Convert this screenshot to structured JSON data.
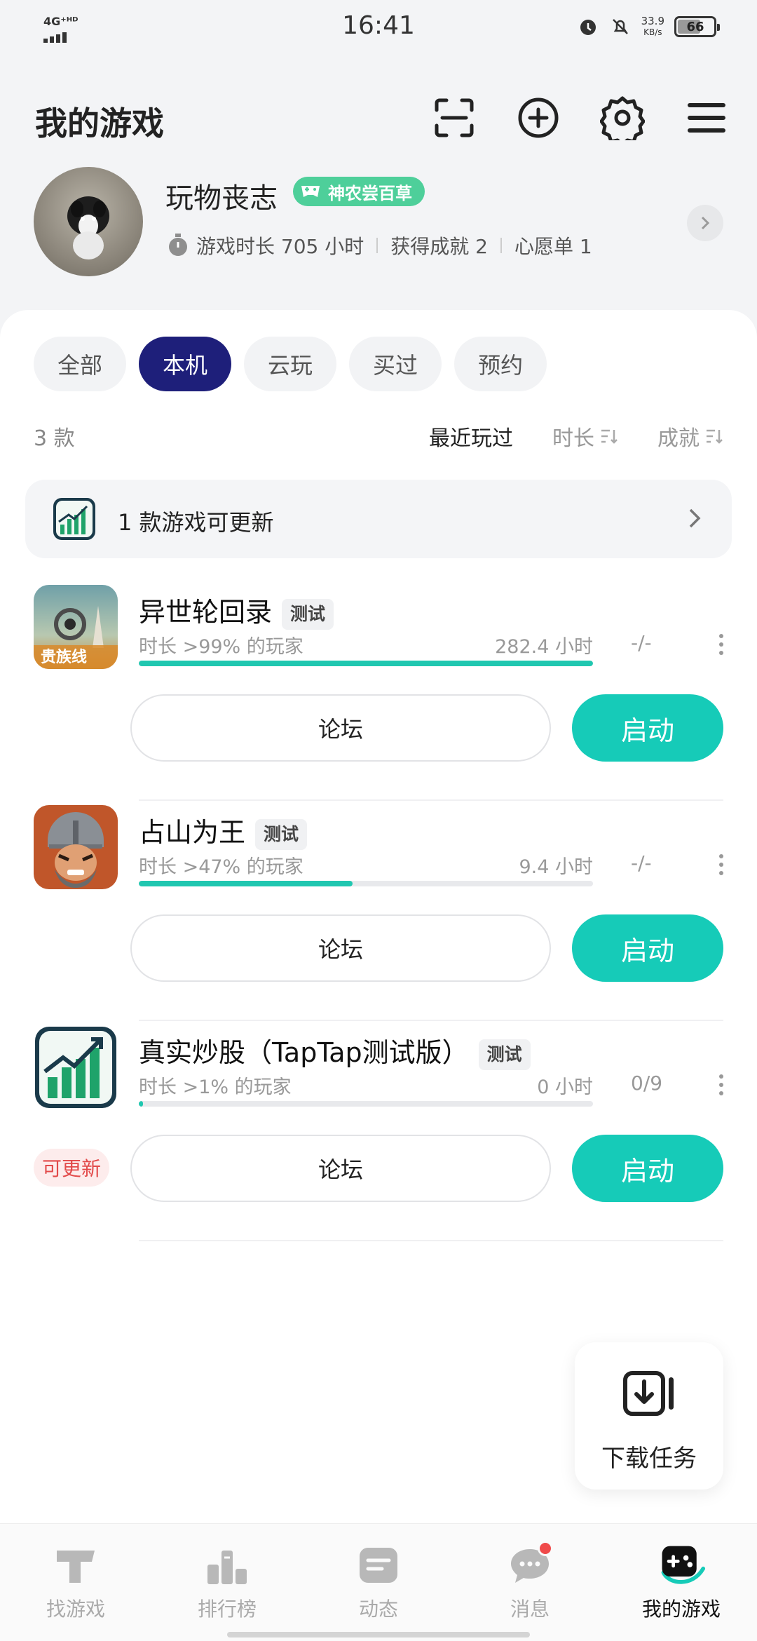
{
  "status_bar": {
    "network": "4G⁺ᴴᴰ",
    "time": "16:41",
    "speed_value": "33.9",
    "speed_unit": "KB/s",
    "battery": "66"
  },
  "header": {
    "title": "我的游戏"
  },
  "profile": {
    "username": "玩物丧志",
    "badge": "神农尝百草",
    "playtime": "游戏时长 705 小时",
    "achievements": "获得成就 2",
    "wishlist": "心愿单 1"
  },
  "filters": {
    "chips": [
      "全部",
      "本机",
      "云玩",
      "买过",
      "预约"
    ],
    "active": "本机"
  },
  "sort": {
    "count": "3 款",
    "recent": "最近玩过",
    "duration": "时长",
    "achievement": "成就"
  },
  "update_banner": {
    "text": "1 款游戏可更新"
  },
  "games": [
    {
      "title": "异世轮回录",
      "tag": "测试",
      "rank_text": "时长 >99% 的玩家",
      "hours": "282.4 小时",
      "progress": 1.0,
      "achievements": "-/-",
      "forum": "论坛",
      "launch": "启动"
    },
    {
      "title": "占山为王",
      "tag": "测试",
      "rank_text": "时长 >47% 的玩家",
      "hours": "9.4 小时",
      "progress": 0.47,
      "achievements": "-/-",
      "forum": "论坛",
      "launch": "启动"
    },
    {
      "title": "真实炒股（TapTap测试版）",
      "tag": "测试",
      "rank_text": "时长 >1% 的玩家",
      "hours": "0 小时",
      "progress": 0.01,
      "achievements": "0/9",
      "update_label": "可更新",
      "forum": "论坛",
      "launch": "启动"
    }
  ],
  "game1_icon_text": "贵族线",
  "download": {
    "label": "下载任务"
  },
  "nav": {
    "items": [
      "找游戏",
      "排行榜",
      "动态",
      "消息",
      "我的游戏"
    ],
    "active": "我的游戏"
  },
  "colors": {
    "accent": "#16cbb8",
    "chip_active": "#1e1f7a",
    "badge": "#4ecf9a",
    "update_red": "#e24a4a"
  }
}
